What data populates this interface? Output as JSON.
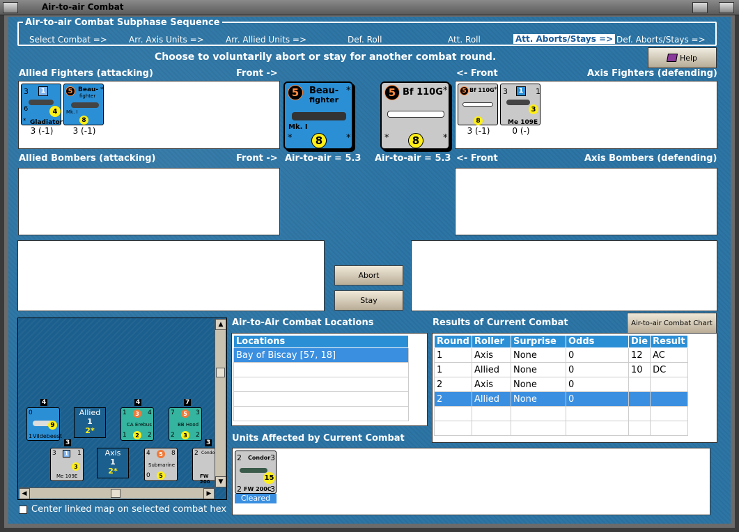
{
  "window": {
    "title": "Air-to-air Combat"
  },
  "sequence": {
    "label": "Air-to-air Combat Subphase Sequence",
    "steps": [
      "Select Combat =>",
      "Arr. Axis Units =>",
      "Arr. Allied Units =>",
      "Def. Roll",
      "Att. Roll",
      "Att. Aborts/Stays =>",
      "Def. Aborts/Stays =>"
    ],
    "active_step": "Att. Aborts/Stays =>"
  },
  "prompt": "Choose to voluntarily abort or stay for another combat round.",
  "help_label": "Help",
  "allied_fighters": {
    "label": "Allied Fighters (attacking)",
    "front": "Front ->",
    "units": [
      {
        "name": "Gladiator",
        "top_left": "3",
        "top_num": "1",
        "side": "6",
        "yellow": "4",
        "corner": "*",
        "score": "3 (-1)"
      },
      {
        "name": "Beau-",
        "name2": "fighter",
        "sub": "Mk. I",
        "circle": "5",
        "yellow": "8",
        "corner": "*",
        "score": "3 (-1)"
      }
    ]
  },
  "axis_fighters": {
    "label": "Axis Fighters (defending)",
    "front": "<- Front",
    "units": [
      {
        "name": "Bf 110G",
        "circle": "5",
        "yellow": "8",
        "corner": "*",
        "score": "3 (-1)"
      },
      {
        "name": "Me 109E",
        "top_left": "3",
        "top_num": "1",
        "top_right": "1",
        "yellow": "3",
        "corner": "*",
        "score": "0 (-)"
      }
    ]
  },
  "combatants": {
    "allied": {
      "circle": "5",
      "name": "Beau-",
      "name2": "fighter",
      "sub": "Mk. I",
      "yellow": "8",
      "corner": "*",
      "rating": "Air-to-air = 5.3"
    },
    "axis": {
      "circle": "5",
      "name": "Bf 110G",
      "yellow": "8",
      "corner": "*",
      "rating": "Air-to-air = 5.3"
    }
  },
  "allied_bombers": {
    "label": "Allied Bombers (attacking)",
    "front": "Front ->"
  },
  "axis_bombers": {
    "label": "Axis Bombers (defending)",
    "front": "<- Front"
  },
  "buttons": {
    "abort": "Abort",
    "stay": "Stay",
    "chart": "Air-to-air Combat Chart"
  },
  "locations": {
    "label": "Air-to-Air Combat Locations",
    "header": "Locations",
    "rows": [
      "Bay of Biscay [57, 18]",
      "",
      "",
      "",
      "",
      ""
    ]
  },
  "results": {
    "label": "Results of Current Combat",
    "headers": [
      "Round",
      "Roller",
      "Surprise",
      "Odds",
      "Die",
      "Result"
    ],
    "rows": [
      [
        "1",
        "Axis",
        "None",
        "0",
        "12",
        "AC"
      ],
      [
        "1",
        "Allied",
        "None",
        "0",
        "10",
        "DC"
      ],
      [
        "2",
        "Axis",
        "None",
        "0",
        "",
        ""
      ],
      [
        "2",
        "Allied",
        "None",
        "0",
        "",
        ""
      ],
      [
        "",
        "",
        "",
        "",
        "",
        ""
      ],
      [
        "",
        "",
        "",
        "",
        "",
        ""
      ]
    ],
    "selected_row": 3
  },
  "affected": {
    "label": "Units Affected by Current Combat",
    "unit": {
      "name": "Condor",
      "sub": "FW 200C",
      "tl": "2",
      "tr": "3",
      "bl": "2",
      "br": "3",
      "yellow": "15",
      "status": "Cleared"
    }
  },
  "map": {
    "panels": [
      {
        "label": "Allied",
        "n": "1",
        "y": "2*"
      },
      {
        "label": "Axis",
        "n": "1",
        "y": "2*"
      }
    ],
    "counts": [
      "4",
      "3",
      "4",
      "7",
      "3"
    ],
    "units": [
      {
        "name": "Vildebeest",
        "tl": "0",
        "y": "9",
        "bl": "1"
      },
      {
        "name": "CA Erebus",
        "tl": "1",
        "c": "3",
        "tr": "4",
        "bl": "1",
        "y": "2",
        "br": "2"
      },
      {
        "name": "BB Hood",
        "tl": "7",
        "c": "5",
        "tr": "3",
        "bl": "2",
        "y": "3",
        "br": "2"
      },
      {
        "name": "Me 109E",
        "tl": "3",
        "top": "1",
        "tr": "1",
        "y": "3"
      },
      {
        "name": "Submarine",
        "tl": "4",
        "c": "5",
        "tr": "8",
        "bl": "0",
        "y": "5"
      },
      {
        "name": "Condor",
        "name2": "FW 200",
        "tl": "2"
      }
    ],
    "checkbox_label": "Center linked map on selected combat hex"
  }
}
